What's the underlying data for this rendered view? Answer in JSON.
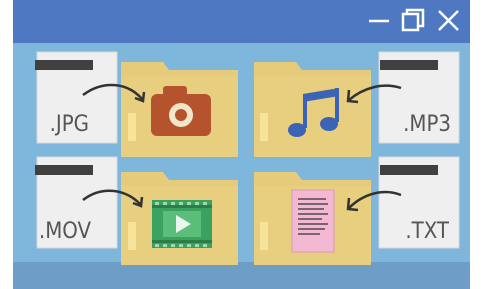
{
  "window": {
    "controls": [
      {
        "name": "minimize-icon"
      },
      {
        "name": "maximize-icon"
      },
      {
        "name": "close-icon"
      }
    ]
  },
  "files": [
    {
      "extension": ".JPG",
      "icon": "camera-icon"
    },
    {
      "extension": ".MP3",
      "icon": "music-note-icon"
    },
    {
      "extension": ".MOV",
      "icon": "film-play-icon"
    },
    {
      "extension": ".TXT",
      "icon": "text-document-icon"
    }
  ],
  "colors": {
    "titlebar": "#4e78c2",
    "background": "#7fb6dc",
    "folder": "#e6cb7b",
    "file_card": "#efefef",
    "camera": "#b5532f",
    "music": "#3b64b7",
    "film": "#3aa160",
    "text_doc": "#f3b9d2"
  }
}
